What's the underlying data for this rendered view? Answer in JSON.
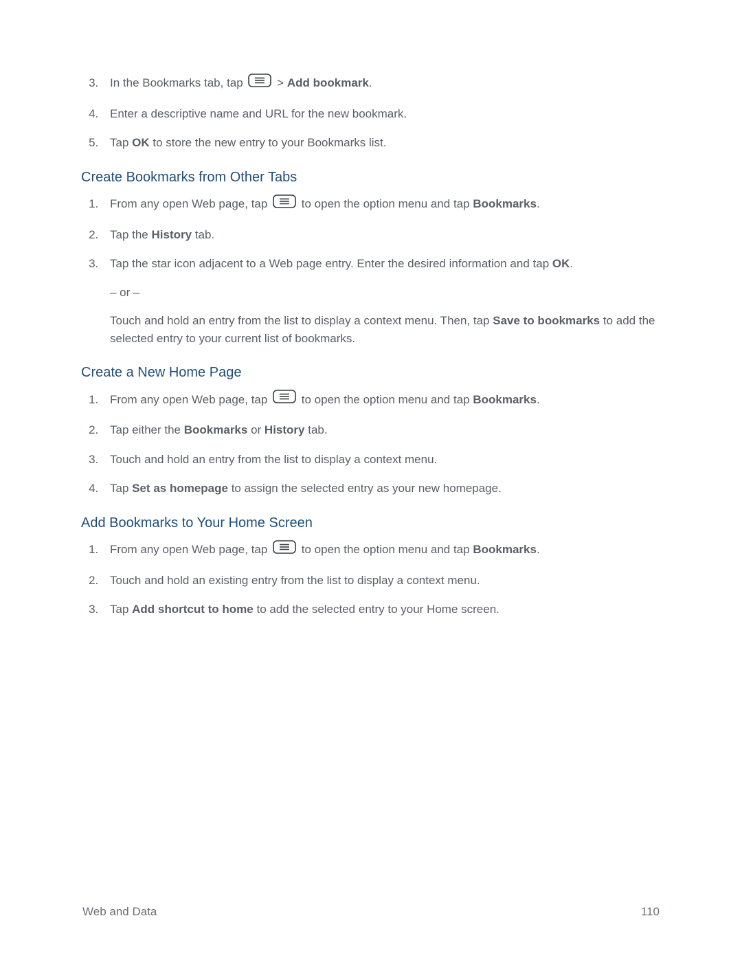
{
  "intro_steps_start": 3,
  "intro_steps": [
    {
      "pre": "In the Bookmarks tab, tap ",
      "icon": true,
      "mid": " > ",
      "bold": "Add bookmark",
      "post": "."
    },
    {
      "pre": "Enter a descriptive name and URL for the new bookmark."
    },
    {
      "pre": "Tap ",
      "bold": "OK",
      "post": " to store the new entry to your Bookmarks list."
    }
  ],
  "sections": {
    "other_tabs": {
      "heading": "Create Bookmarks from Other Tabs",
      "steps": [
        {
          "pre": "From any open Web page, tap ",
          "icon": true,
          "mid": " to open the option menu and tap ",
          "bold": "Bookmarks",
          "post": "."
        },
        {
          "pre": "Tap the ",
          "bold": "History",
          "post": " tab."
        },
        {
          "pre": "Tap the star icon adjacent to a Web page entry. Enter the desired information and tap ",
          "bold": "OK",
          "post": ".",
          "sub_or": "– or –",
          "sub_pre": "Touch and hold an entry from the list to display a context menu. Then, tap ",
          "sub_bold": "Save to bookmarks",
          "sub_post": " to add the selected entry to your current list of bookmarks."
        }
      ]
    },
    "new_home": {
      "heading": "Create a New Home Page",
      "steps": [
        {
          "pre": "From any open Web page, tap ",
          "icon": true,
          "mid": " to open the option menu and tap ",
          "bold": "Bookmarks",
          "post": "."
        },
        {
          "segments": [
            {
              "text": "Tap either the "
            },
            {
              "text": "Bookmarks",
              "bold": true
            },
            {
              "text": " or "
            },
            {
              "text": "History",
              "bold": true
            },
            {
              "text": " tab."
            }
          ]
        },
        {
          "pre": "Touch and hold an entry from the list to display a context menu."
        },
        {
          "pre": "Tap ",
          "bold": "Set as homepage",
          "post": " to assign the selected entry as your new homepage."
        }
      ]
    },
    "add_home_screen": {
      "heading": "Add Bookmarks to Your Home Screen",
      "steps": [
        {
          "pre": "From any open Web page, tap ",
          "icon": true,
          "mid": " to open the option menu and tap ",
          "bold": "Bookmarks",
          "post": "."
        },
        {
          "pre": "Touch and hold an existing entry from the list to display a context menu."
        },
        {
          "pre": "Tap ",
          "bold": "Add shortcut to home",
          "post": " to add the selected entry to your Home screen."
        }
      ]
    }
  },
  "footer": {
    "left": "Web and Data",
    "right": "110"
  }
}
